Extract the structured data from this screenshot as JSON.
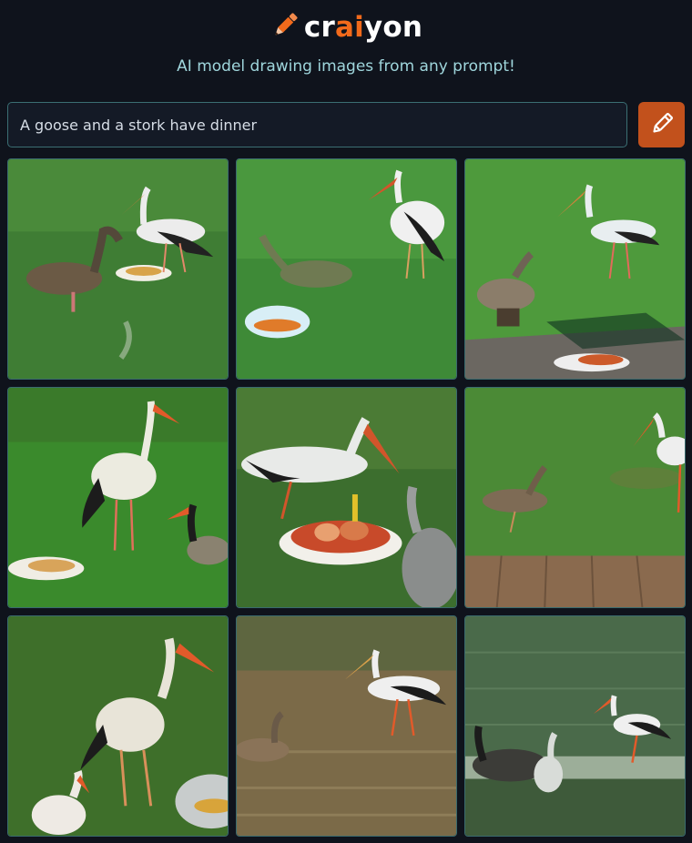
{
  "brand": {
    "logo_parts": [
      "cr",
      "ai",
      "yon"
    ],
    "accent_color": "#f26a1b",
    "icon": "pencil-icon"
  },
  "tagline": "AI model drawing images from any prompt!",
  "prompt": {
    "value": "A goose and a stork have dinner"
  },
  "draw_button": {
    "icon": "pencil-icon",
    "color": "#c2511c"
  },
  "results": {
    "count": 9,
    "scene_icons": [
      "grass-scene-goose-stork-plate",
      "grass-scene-stork-goose-bowl",
      "grass-scene-stork-duck-boardwalk",
      "grass-scene-stork-goose-plate",
      "grass-scene-stork-heron-meat-bowl",
      "grass-scene-goose-stork-deck",
      "grass-scene-stork-goose-bowl",
      "water-scene-stork-goose",
      "water-scene-stork-geese"
    ]
  }
}
